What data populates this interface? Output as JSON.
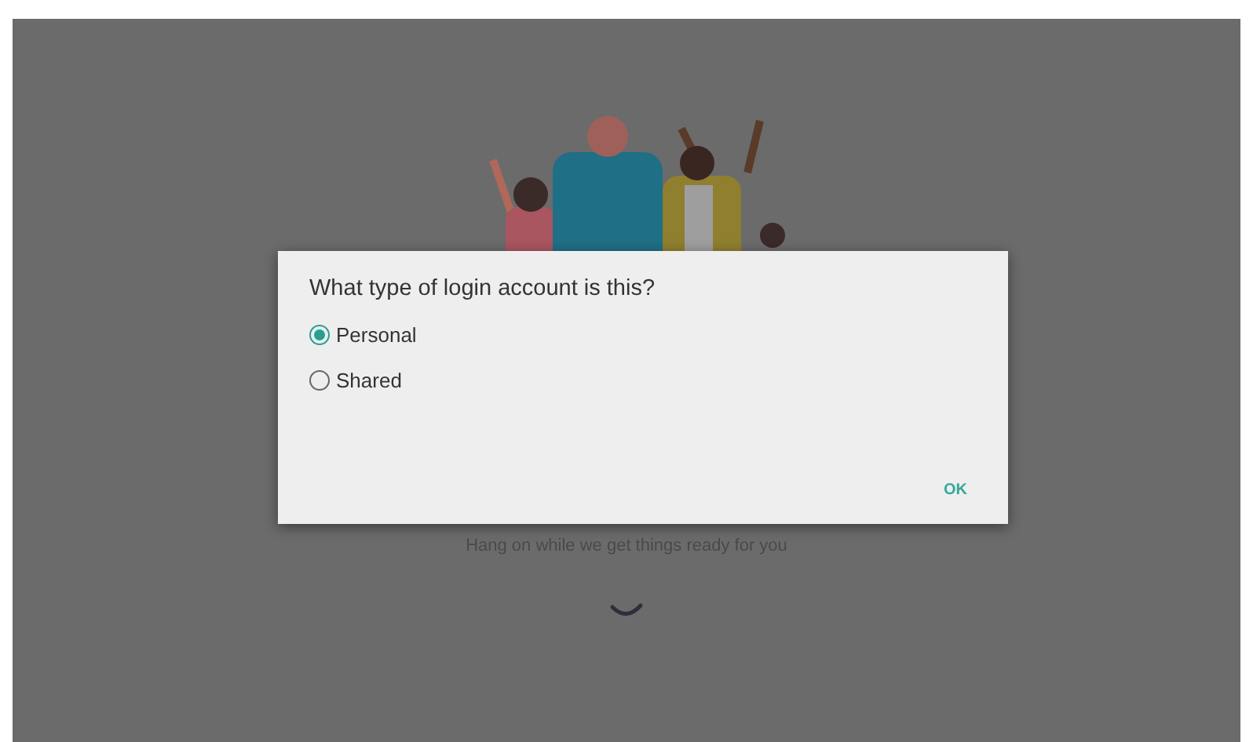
{
  "background": {
    "message": "Hang on while we get things ready for you"
  },
  "dialog": {
    "title": "What type of login account is this?",
    "options": [
      {
        "label": "Personal",
        "selected": true
      },
      {
        "label": "Shared",
        "selected": false
      }
    ],
    "buttons": [
      "OK"
    ]
  }
}
